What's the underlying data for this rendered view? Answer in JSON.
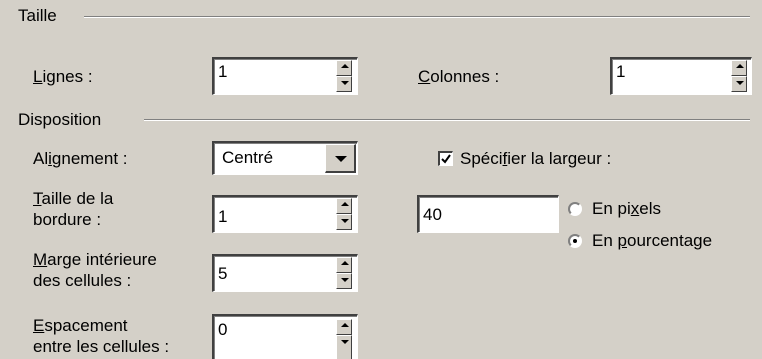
{
  "taille": {
    "heading": "Taille",
    "lignes": {
      "label_ul": "L",
      "label_rest": "ignes :",
      "value": "1"
    },
    "colonnes": {
      "label_ul": "C",
      "label_rest": "olonnes :",
      "value": "1"
    }
  },
  "disposition": {
    "heading": "Disposition",
    "alignement": {
      "label_pre": "Al",
      "label_ul": "i",
      "label_post": "gnement :",
      "value": "Centré"
    },
    "bordure": {
      "label_ul": "T",
      "label_line1_rest": "aille de la",
      "label_line2": "bordure :",
      "value": "1"
    },
    "marge": {
      "label_ul": "M",
      "label_line1_rest": "arge intérieure",
      "label_line2": "des cellules :",
      "value": "5"
    },
    "espacement": {
      "label_ul": "E",
      "label_line1_rest": "spacement",
      "label_line2": "entre les cellules :",
      "value": "0"
    },
    "largeur": {
      "checkbox_pre": "Spéci",
      "checkbox_ul": "f",
      "checkbox_post": "ier la largeur :",
      "checked": true,
      "value": "40",
      "unit_pixels": {
        "pre": "En pi",
        "ul": "x",
        "post": "els",
        "selected": false
      },
      "unit_pourcentage": {
        "pre": "En ",
        "ul": "p",
        "post": "ourcentage",
        "selected": true
      }
    }
  }
}
